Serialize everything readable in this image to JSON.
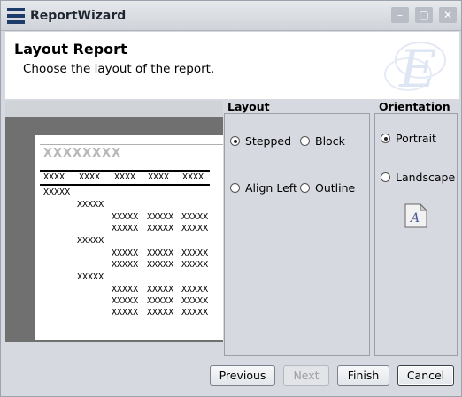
{
  "window": {
    "title": "ReportWizard",
    "controls": [
      "–",
      "▢",
      "✕"
    ]
  },
  "header": {
    "title": "Layout Report",
    "subtitle": "Choose the layout of the report.",
    "logo_letter": "E"
  },
  "preview": {
    "placeholder_title": "XXXXXXXX",
    "header_cells": [
      "XXXX",
      "XXXX",
      "XXXX",
      "XXXX",
      "XXXX"
    ],
    "level1": "XXXXX",
    "level2": "XXXXX",
    "detail_cell": "XXXXX"
  },
  "layout_group": {
    "label": "Layout",
    "options": [
      {
        "label": "Stepped",
        "selected": true
      },
      {
        "label": "Block",
        "selected": false
      },
      {
        "label": "Align Left",
        "selected": false
      },
      {
        "label": "Outline",
        "selected": false
      }
    ]
  },
  "orientation_group": {
    "label": "Orientation",
    "options": [
      {
        "label": "Portrait",
        "selected": true
      },
      {
        "label": "Landscape",
        "selected": false
      }
    ],
    "icon_letter": "A"
  },
  "buttons": {
    "previous": "Previous",
    "next": "Next",
    "finish": "Finish",
    "cancel": "Cancel"
  }
}
